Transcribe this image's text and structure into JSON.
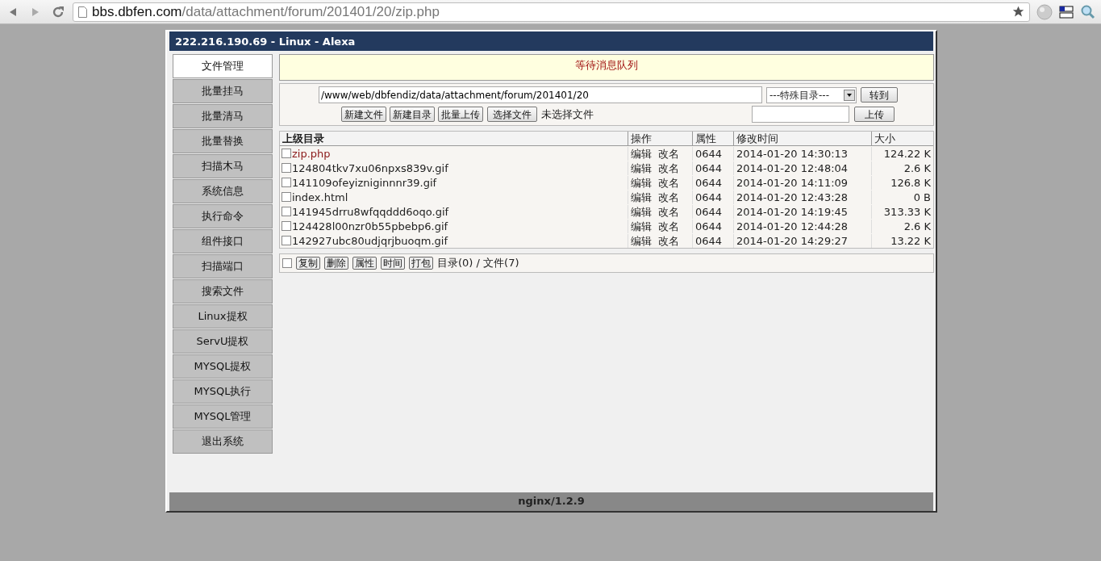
{
  "browser": {
    "url_host": "bbs.dbfen.com",
    "url_path": "/data/attachment/forum/201401/20/zip.php"
  },
  "header": {
    "title": "222.216.190.69 - Linux - Alexa"
  },
  "sidebar": {
    "items": [
      {
        "label": "文件管理",
        "selected": true
      },
      {
        "label": "批量挂马",
        "selected": false
      },
      {
        "label": "批量清马",
        "selected": false
      },
      {
        "label": "批量替换",
        "selected": false
      },
      {
        "label": "扫描木马",
        "selected": false
      },
      {
        "label": "系统信息",
        "selected": false
      },
      {
        "label": "执行命令",
        "selected": false
      },
      {
        "label": "组件接口",
        "selected": false
      },
      {
        "label": "扫描端口",
        "selected": false
      },
      {
        "label": "搜索文件",
        "selected": false
      },
      {
        "label": "Linux提权",
        "selected": false
      },
      {
        "label": "ServU提权",
        "selected": false
      },
      {
        "label": "MYSQL提权",
        "selected": false
      },
      {
        "label": "MYSQL执行",
        "selected": false
      },
      {
        "label": "MYSQL管理",
        "selected": false
      },
      {
        "label": "退出系统",
        "selected": false
      }
    ]
  },
  "message": "等待消息队列",
  "toolbar": {
    "path": "/www/web/dbfendiz/data/attachment/forum/201401/20",
    "special_dir": "---特殊目录---",
    "goto_button": "转到",
    "buttons": [
      "新建文件",
      "新建目录",
      "批量上传"
    ],
    "choose_file_button": "选择文件",
    "file_status": "未选择文件",
    "upload_button": "上传"
  },
  "table": {
    "columns": [
      "上级目录",
      "操作",
      "属性",
      "修改时间",
      "大小"
    ],
    "rows": [
      {
        "name": "zip.php",
        "current": true,
        "checked": false,
        "actions": [
          "编辑",
          "改名"
        ],
        "perm": "0644",
        "mtime": "2014-01-20 14:30:13",
        "size": "124.22 K"
      },
      {
        "name": "124804tkv7xu06npxs839v.gif",
        "current": false,
        "checked": false,
        "actions": [
          "编辑",
          "改名"
        ],
        "perm": "0644",
        "mtime": "2014-01-20 12:48:04",
        "size": "2.6 K"
      },
      {
        "name": "141109ofeyizniginnnr39.gif",
        "current": false,
        "checked": false,
        "actions": [
          "编辑",
          "改名"
        ],
        "perm": "0644",
        "mtime": "2014-01-20 14:11:09",
        "size": "126.8 K"
      },
      {
        "name": "index.html",
        "current": false,
        "checked": false,
        "actions": [
          "编辑",
          "改名"
        ],
        "perm": "0644",
        "mtime": "2014-01-20 12:43:28",
        "size": "0 B"
      },
      {
        "name": "141945drru8wfqqddd6oqo.gif",
        "current": false,
        "checked": false,
        "actions": [
          "编辑",
          "改名"
        ],
        "perm": "0644",
        "mtime": "2014-01-20 14:19:45",
        "size": "313.33 K"
      },
      {
        "name": "124428l00nzr0b55pbebp6.gif",
        "current": false,
        "checked": false,
        "actions": [
          "编辑",
          "改名"
        ],
        "perm": "0644",
        "mtime": "2014-01-20 12:44:28",
        "size": "2.6 K"
      },
      {
        "name": "142927ubc80udjqrjbuoqm.gif",
        "current": false,
        "checked": false,
        "actions": [
          "编辑",
          "改名"
        ],
        "perm": "0644",
        "mtime": "2014-01-20 14:29:27",
        "size": "13.22 K"
      }
    ]
  },
  "bulk": {
    "select_all": false,
    "buttons": [
      "复制",
      "删除",
      "属性",
      "时间",
      "打包"
    ],
    "summary": "目录(0) / 文件(7)"
  },
  "footer": "nginx/1.2.9"
}
